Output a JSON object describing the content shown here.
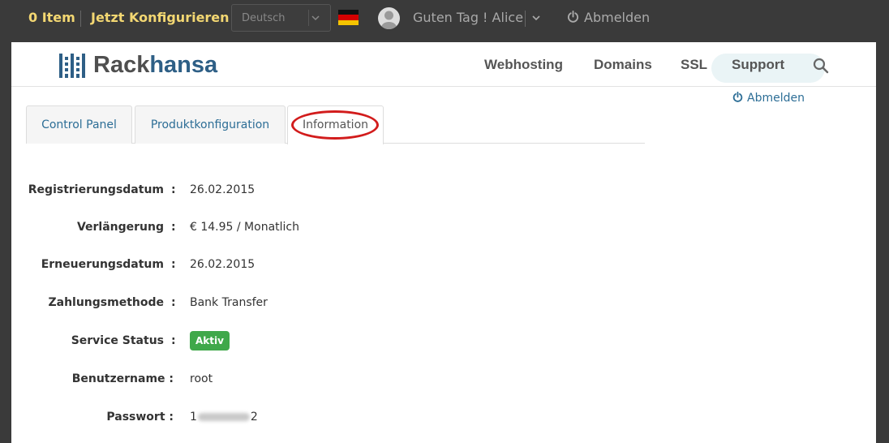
{
  "topbar": {
    "cart_label": "0 Item",
    "configure_label": "Jetzt Konfigurieren",
    "language": "Deutsch",
    "greeting": "Guten Tag ! Alice",
    "logout_label": "Abmelden"
  },
  "header": {
    "logo_rack": "Rack",
    "logo_hansa": "hansa",
    "nav": [
      "Webhosting",
      "Domains",
      "SSL",
      "Support"
    ],
    "sub_logout_label": "Abmelden"
  },
  "tabs": [
    {
      "label": "Control Panel",
      "active": false
    },
    {
      "label": "Produktkonfiguration",
      "active": false
    },
    {
      "label": "Information",
      "active": true
    }
  ],
  "info": {
    "registration": {
      "label": "Registrierungsdatum",
      "value": "26.02.2015"
    },
    "renewal": {
      "label": "Verlängerung",
      "value": "€ 14.95 / Monatlich"
    },
    "renewal_date": {
      "label": "Erneuerungsdatum",
      "value": "26.02.2015"
    },
    "payment": {
      "label": "Zahlungsmethode",
      "value": "Bank Transfer"
    },
    "status": {
      "label": "Service Status",
      "value": "Aktiv"
    },
    "username": {
      "label": "Benutzername :",
      "value": "root"
    },
    "password": {
      "label": "Passwort :",
      "value_start": "1",
      "value_end": "2"
    }
  },
  "colors": {
    "topbar_bg": "#3a3a3a",
    "accent_yellow": "#f3d772",
    "link_blue": "#2d6e96",
    "status_green": "#3fa84a",
    "annotation_red": "#d21c1c"
  }
}
